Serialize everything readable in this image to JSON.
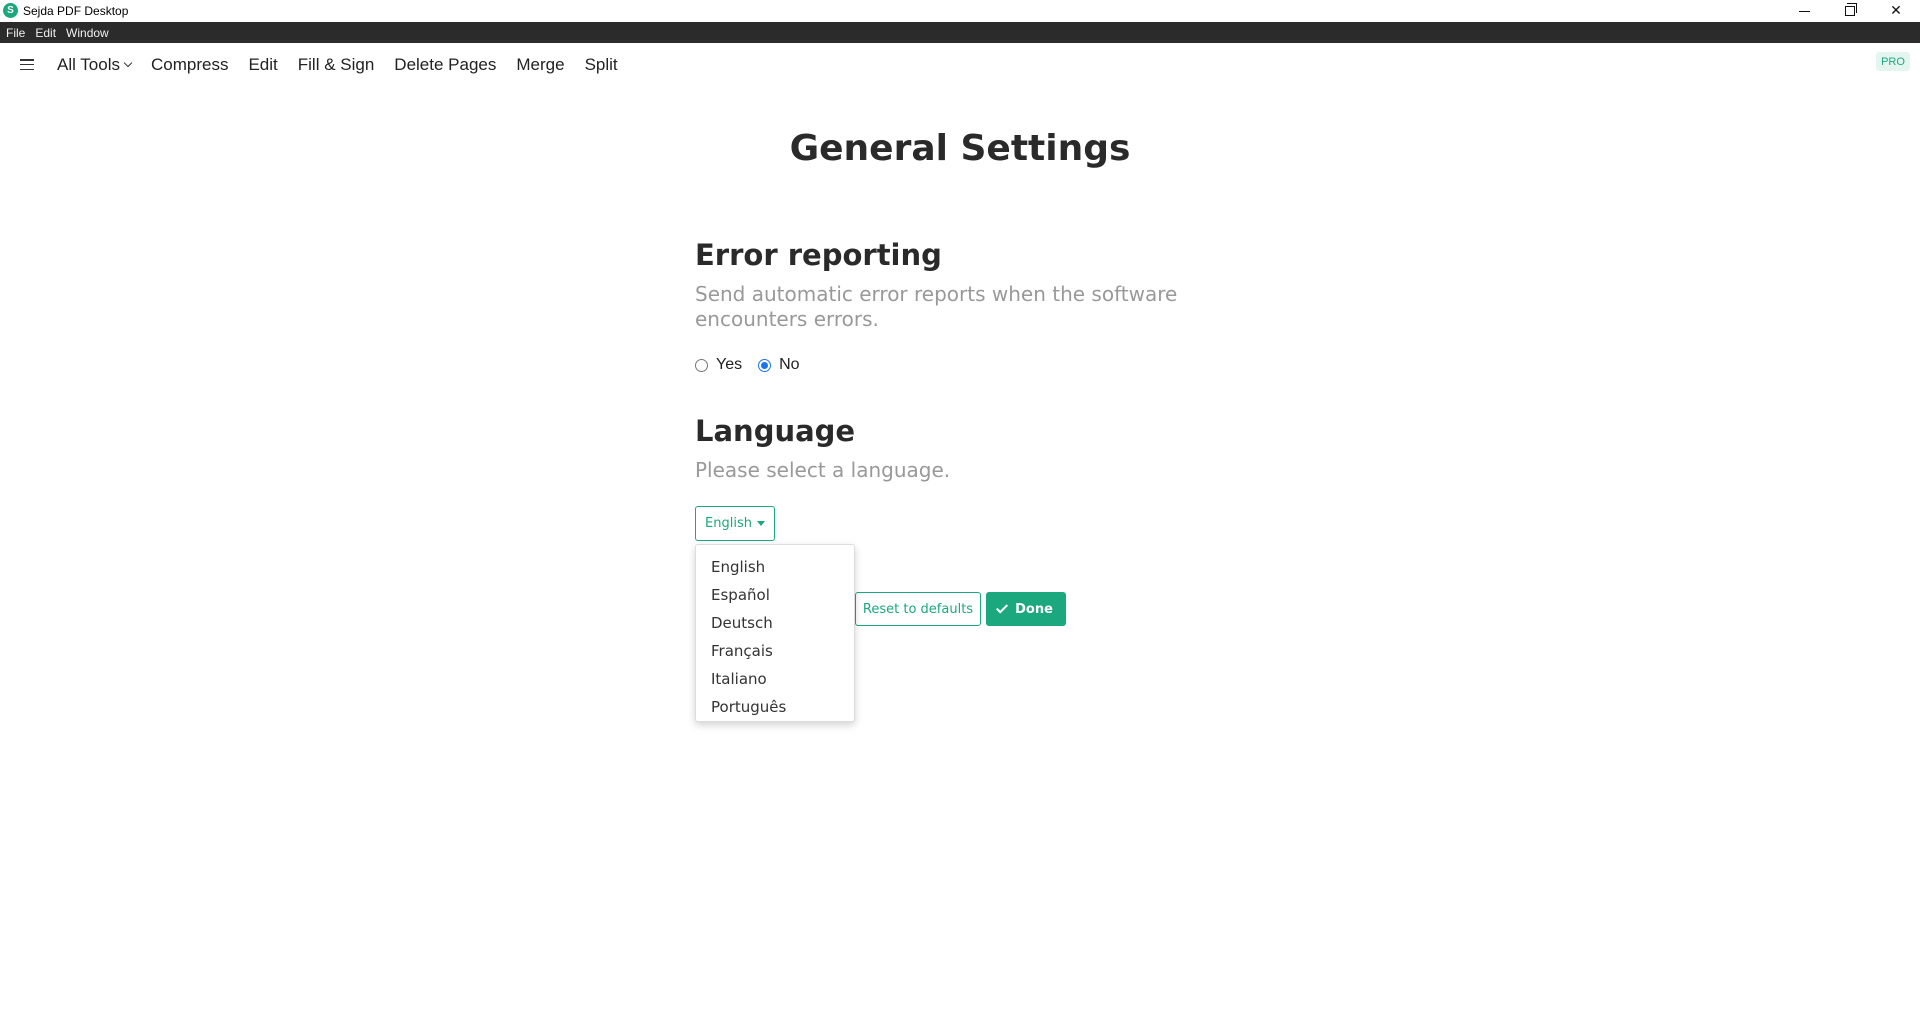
{
  "window": {
    "title": "Sejda PDF Desktop",
    "icon_letter": "S",
    "controls": [
      "minimize",
      "restore",
      "close"
    ]
  },
  "menubar": {
    "items": [
      "File",
      "Edit",
      "Window"
    ]
  },
  "nav": {
    "items": [
      "All Tools",
      "Compress",
      "Edit",
      "Fill & Sign",
      "Delete Pages",
      "Merge",
      "Split"
    ],
    "pro_badge": "PRO"
  },
  "page": {
    "title": "General Settings"
  },
  "error_reporting": {
    "title": "Error reporting",
    "description": "Send automatic error reports when the software encounters errors.",
    "options": [
      "Yes",
      "No"
    ],
    "selected": "No"
  },
  "language": {
    "title": "Language",
    "description": "Please select a language.",
    "selected": "English",
    "options": [
      "English",
      "Español",
      "Deutsch",
      "Français",
      "Italiano",
      "Português"
    ]
  },
  "actions": {
    "reset_label": "Reset to defaults",
    "done_label": "Done"
  },
  "colors": {
    "accent": "#1ba87e",
    "menubar_bg": "#2b2b2b",
    "radio_checked": "#1a73e8"
  }
}
